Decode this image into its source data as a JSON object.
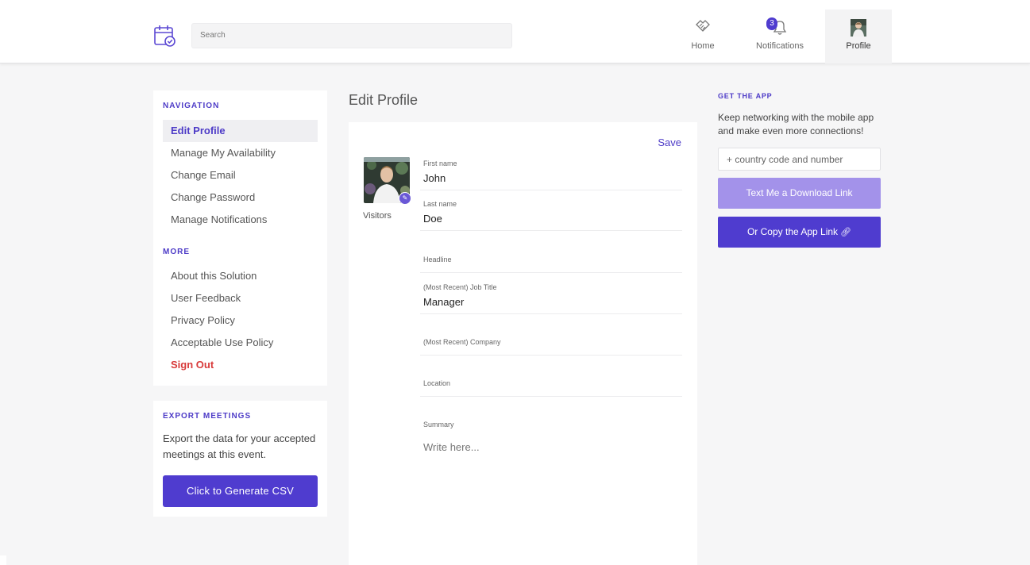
{
  "header": {
    "search_placeholder": "Search",
    "nav": {
      "home": "Home",
      "notifications": "Notifications",
      "notifications_count": "3",
      "profile": "Profile"
    }
  },
  "sidebar": {
    "navigation_title": "NAVIGATION",
    "navigation_items": [
      {
        "label": "Edit Profile"
      },
      {
        "label": "Manage My Availability"
      },
      {
        "label": "Change Email"
      },
      {
        "label": "Change Password"
      },
      {
        "label": "Manage Notifications"
      }
    ],
    "more_title": "MORE",
    "more_items": [
      {
        "label": "About this Solution"
      },
      {
        "label": "User Feedback"
      },
      {
        "label": "Privacy Policy"
      },
      {
        "label": "Acceptable Use Policy"
      },
      {
        "label": "Sign Out"
      }
    ]
  },
  "export": {
    "title": "EXPORT MEETINGS",
    "text": "Export the data for your accepted meetings at this event.",
    "button": "Click to Generate CSV"
  },
  "main": {
    "title": "Edit Profile",
    "save": "Save",
    "photo_caption": "Visitors",
    "fields": [
      {
        "label": "First name",
        "value": "John"
      },
      {
        "label": "Last name",
        "value": "Doe"
      },
      {
        "label": "Headline",
        "value": ""
      },
      {
        "label": "(Most Recent) Job Title",
        "value": "Manager"
      },
      {
        "label": "(Most Recent) Company",
        "value": ""
      },
      {
        "label": "Location",
        "value": ""
      },
      {
        "label": "Summary",
        "value": ""
      }
    ],
    "summary_placeholder": "Write here..."
  },
  "app": {
    "title": "GET THE APP",
    "text": "Keep networking with the mobile app and make even more connections!",
    "phone_placeholder": "+ country code and number",
    "text_button": "Text Me a Download Link",
    "copy_button": "Or Copy the App Link"
  },
  "colors": {
    "accent": "#4f3ccf",
    "accent_light": "#a392ea",
    "danger": "#d83a3a",
    "background": "#f6f6f7"
  }
}
